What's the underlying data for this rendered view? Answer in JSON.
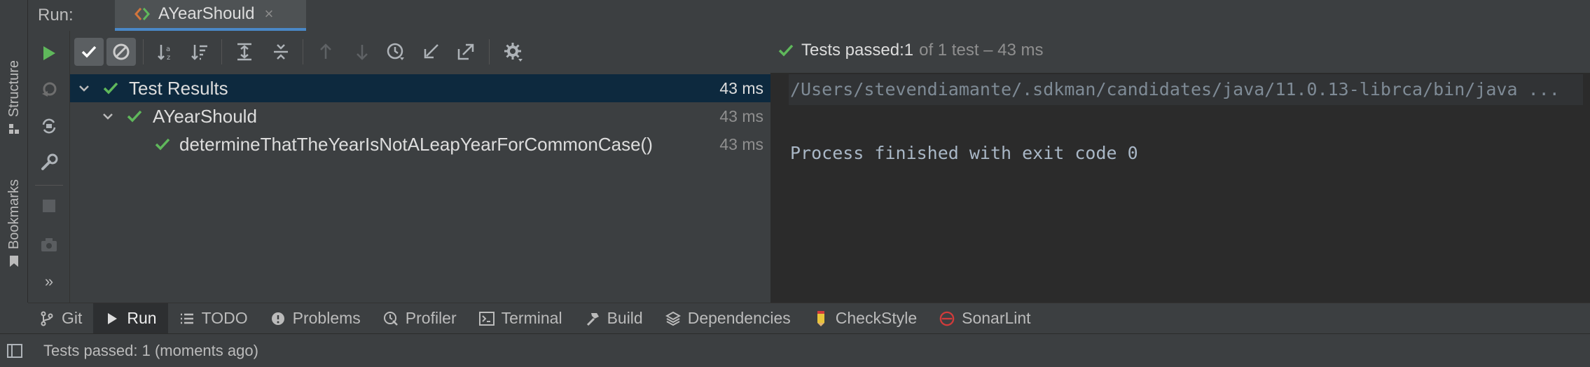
{
  "run_header": {
    "label": "Run:",
    "tab_title": "AYearShould",
    "tab_close": "×"
  },
  "side_tabs": {
    "structure": "Structure",
    "bookmarks": "Bookmarks",
    "more": "»"
  },
  "summary": {
    "prefix": "Tests passed: ",
    "count": "1",
    "rest": "of 1 test – 43 ms"
  },
  "tree": {
    "rows": [
      {
        "name": "Test Results",
        "time": "43 ms"
      },
      {
        "name": "AYearShould",
        "time": "43 ms"
      },
      {
        "name": "determineThatTheYearIsNotALeapYearForCommonCase()",
        "time": "43 ms"
      }
    ]
  },
  "console": {
    "command": "/Users/stevendiamante/.sdkman/candidates/java/11.0.13-librca/bin/java ...",
    "exit_message": "Process finished with exit code 0"
  },
  "tool_windows": [
    {
      "label": "Git",
      "icon": "git-branch-icon"
    },
    {
      "label": "Run",
      "icon": "run-icon"
    },
    {
      "label": "TODO",
      "icon": "list-icon"
    },
    {
      "label": "Problems",
      "icon": "info-circle-icon"
    },
    {
      "label": "Profiler",
      "icon": "profiler-icon"
    },
    {
      "label": "Terminal",
      "icon": "terminal-icon"
    },
    {
      "label": "Build",
      "icon": "hammer-icon"
    },
    {
      "label": "Dependencies",
      "icon": "layers-icon"
    },
    {
      "label": "CheckStyle",
      "icon": "pencil-icon"
    },
    {
      "label": "SonarLint",
      "icon": "sonarlint-icon"
    }
  ],
  "status_bar": {
    "text": "Tests passed: 1 (moments ago)"
  },
  "colors": {
    "pass_green": "#5fb85b",
    "selection": "#0d293e",
    "accent_blue": "#4a88c7",
    "sonar_red": "#d13b3b"
  }
}
